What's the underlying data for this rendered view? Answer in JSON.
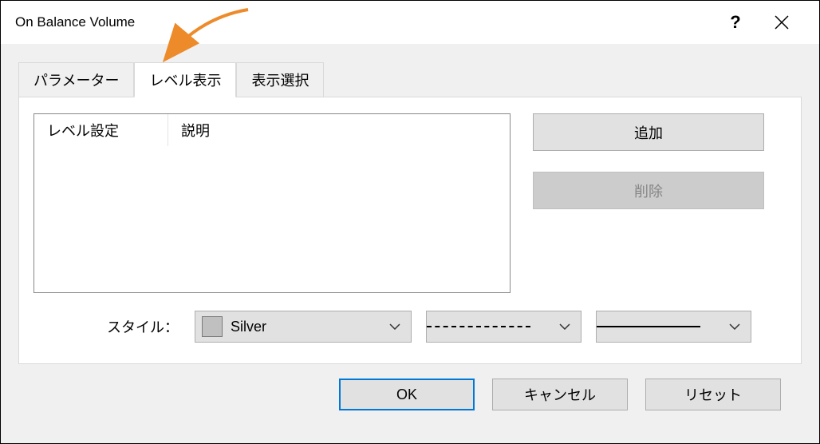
{
  "window": {
    "title": "On Balance Volume"
  },
  "tabs": [
    {
      "label": "パラメーター",
      "active": false
    },
    {
      "label": "レベル表示",
      "active": true
    },
    {
      "label": "表示選択",
      "active": false
    }
  ],
  "table": {
    "headers": {
      "level": "レベル設定",
      "desc": "説明"
    }
  },
  "buttons": {
    "add": "追加",
    "remove": "削除"
  },
  "style": {
    "label": "スタイル：",
    "color_name": "Silver",
    "color_hex": "#c0c0c0"
  },
  "footer": {
    "ok": "OK",
    "cancel": "キャンセル",
    "reset": "リセット"
  }
}
